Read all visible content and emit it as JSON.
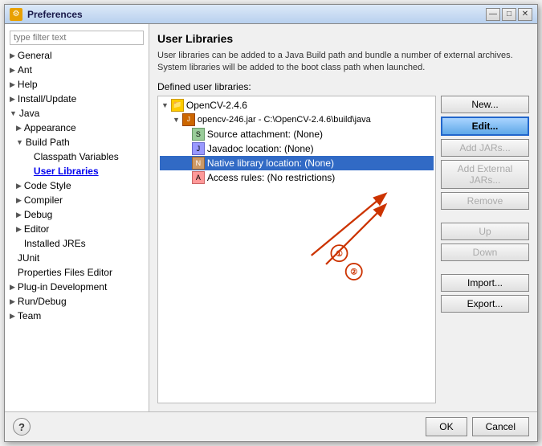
{
  "window": {
    "title": "Preferences",
    "icon": "⚙",
    "titlebar_buttons": [
      "—",
      "□",
      "✕"
    ]
  },
  "sidebar": {
    "filter_placeholder": "type filter text",
    "items": [
      {
        "id": "general",
        "label": "General",
        "level": 0,
        "has_arrow": true,
        "expanded": false
      },
      {
        "id": "ant",
        "label": "Ant",
        "level": 0,
        "has_arrow": true,
        "expanded": false
      },
      {
        "id": "help",
        "label": "Help",
        "level": 0,
        "has_arrow": true,
        "expanded": false
      },
      {
        "id": "install-update",
        "label": "Install/Update",
        "level": 0,
        "has_arrow": true,
        "expanded": false
      },
      {
        "id": "java",
        "label": "Java",
        "level": 0,
        "has_arrow": true,
        "expanded": true
      },
      {
        "id": "appearance",
        "label": "Appearance",
        "level": 1,
        "has_arrow": true,
        "expanded": false
      },
      {
        "id": "build-path",
        "label": "Build Path",
        "level": 1,
        "has_arrow": true,
        "expanded": true
      },
      {
        "id": "classpath-variables",
        "label": "Classpath Variables",
        "level": 2,
        "has_arrow": false,
        "expanded": false
      },
      {
        "id": "user-libraries",
        "label": "User Libraries",
        "level": 2,
        "has_arrow": false,
        "expanded": false,
        "selected": true
      },
      {
        "id": "code-style",
        "label": "Code Style",
        "level": 1,
        "has_arrow": true,
        "expanded": false
      },
      {
        "id": "compiler",
        "label": "Compiler",
        "level": 1,
        "has_arrow": true,
        "expanded": false
      },
      {
        "id": "debug",
        "label": "Debug",
        "level": 1,
        "has_arrow": true,
        "expanded": false
      },
      {
        "id": "editor",
        "label": "Editor",
        "level": 1,
        "has_arrow": true,
        "expanded": false
      },
      {
        "id": "installed-jres",
        "label": "Installed JREs",
        "level": 1,
        "has_arrow": false,
        "expanded": false
      },
      {
        "id": "junit",
        "label": "JUnit",
        "level": 0,
        "has_arrow": false,
        "expanded": false
      },
      {
        "id": "properties-files-editor",
        "label": "Properties Files Editor",
        "level": 0,
        "has_arrow": false,
        "expanded": false
      },
      {
        "id": "plugin-development",
        "label": "Plug-in Development",
        "level": 0,
        "has_arrow": true,
        "expanded": false
      },
      {
        "id": "run-debug",
        "label": "Run/Debug",
        "level": 0,
        "has_arrow": true,
        "expanded": false
      },
      {
        "id": "team",
        "label": "Team",
        "level": 0,
        "has_arrow": true,
        "expanded": false
      }
    ]
  },
  "main": {
    "title": "User Libraries",
    "description": "User libraries can be added to a Java Build path and bundle a number of external archives. System libraries will be added to the boot class path when launched.",
    "defined_label": "Defined user libraries:",
    "lib_tree": {
      "items": [
        {
          "id": "opencv-246",
          "label": "OpenCV-2.4.6",
          "level": 0,
          "type": "folder",
          "expanded": true
        },
        {
          "id": "opencv-jar",
          "label": "opencv-246.jar - C:\\OpenCV-2.4.6\\build\\java",
          "level": 1,
          "type": "jar",
          "expanded": true
        },
        {
          "id": "source-attachment",
          "label": "Source attachment: (None)",
          "level": 2,
          "type": "src"
        },
        {
          "id": "javadoc-location",
          "label": "Javadoc location: (None)",
          "level": 2,
          "type": "javadoc"
        },
        {
          "id": "native-library",
          "label": "Native library location: (None)",
          "level": 2,
          "type": "native",
          "selected": true
        },
        {
          "id": "access-rules",
          "label": "Access rules: (No restrictions)",
          "level": 2,
          "type": "access"
        }
      ]
    },
    "buttons": {
      "new": "New...",
      "edit": "Edit...",
      "add_jars": "Add JARs...",
      "add_external_jars": "Add External JARs...",
      "remove": "Remove",
      "up": "Up",
      "down": "Down",
      "import": "Import...",
      "export": "Export..."
    }
  },
  "bottom": {
    "ok_label": "OK",
    "cancel_label": "Cancel",
    "help_symbol": "?"
  }
}
